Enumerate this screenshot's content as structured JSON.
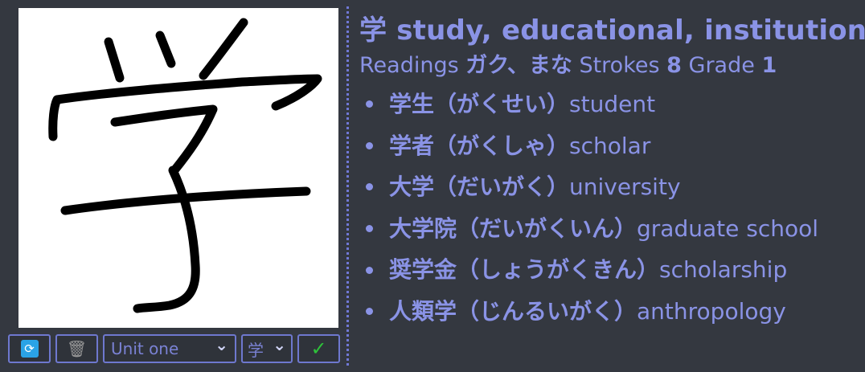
{
  "kanji": "学",
  "meaning": "study, educational, institution",
  "info": {
    "readings_label": "Readings",
    "readings": "ガク、まな",
    "strokes_label": "Strokes",
    "strokes": "8",
    "grade_label": "Grade",
    "grade": "1"
  },
  "examples": [
    {
      "jp": "学生（がくせい）",
      "en": "student"
    },
    {
      "jp": "学者（がくしゃ）",
      "en": "scholar"
    },
    {
      "jp": "大学（だいがく）",
      "en": "university"
    },
    {
      "jp": "大学院（だいがくいん）",
      "en": "graduate school"
    },
    {
      "jp": "奨学金（しょうがくきん）",
      "en": "scholarship"
    },
    {
      "jp": "人類学（じんるいがく）",
      "en": "anthropology"
    }
  ],
  "toolbar": {
    "unit_select": "Unit one",
    "kanji_select": "学",
    "check_glyph": "✓",
    "trash_glyph": "🗑",
    "refresh_glyph": "⟳",
    "chevron_glyph": "⌄"
  },
  "colors": {
    "background": "#343840",
    "accent": "#8a93e6",
    "refresh": "#2aa3e6",
    "check": "#2ec23a"
  }
}
